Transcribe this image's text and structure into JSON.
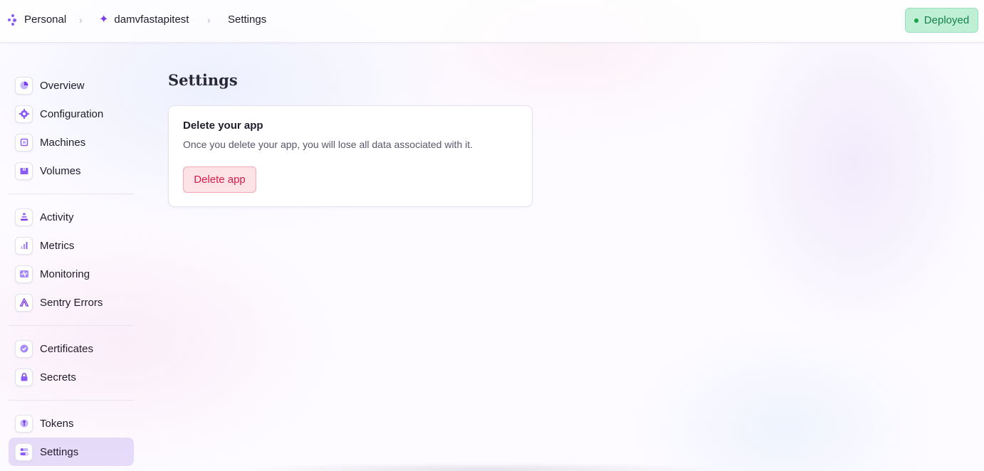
{
  "breadcrumb": {
    "org": "Personal",
    "app": "damvfastapitest",
    "page": "Settings"
  },
  "status": {
    "label": "Deployed",
    "color": "#16a34a"
  },
  "sidebar": {
    "groups": [
      [
        {
          "label": "Overview",
          "icon": "pie-chart-icon"
        },
        {
          "label": "Configuration",
          "icon": "gear-icon"
        },
        {
          "label": "Machines",
          "icon": "chip-icon"
        },
        {
          "label": "Volumes",
          "icon": "box-icon"
        }
      ],
      [
        {
          "label": "Activity",
          "icon": "stack-icon"
        },
        {
          "label": "Metrics",
          "icon": "bar-chart-icon"
        },
        {
          "label": "Monitoring",
          "icon": "pulse-icon"
        },
        {
          "label": "Sentry Errors",
          "icon": "sentry-icon"
        }
      ],
      [
        {
          "label": "Certificates",
          "icon": "check-badge-icon"
        },
        {
          "label": "Secrets",
          "icon": "lock-icon"
        }
      ],
      [
        {
          "label": "Tokens",
          "icon": "token-icon"
        },
        {
          "label": "Settings",
          "icon": "toggles-icon",
          "active": true
        }
      ]
    ]
  },
  "main": {
    "title": "Settings",
    "card": {
      "heading": "Delete your app",
      "description": "Once you delete your app, you will lose all data associated with it.",
      "button_label": "Delete app"
    }
  },
  "colors": {
    "accent": "#8b5cf6",
    "danger": "#d81b48",
    "active_bg": "#ddd2f7"
  }
}
